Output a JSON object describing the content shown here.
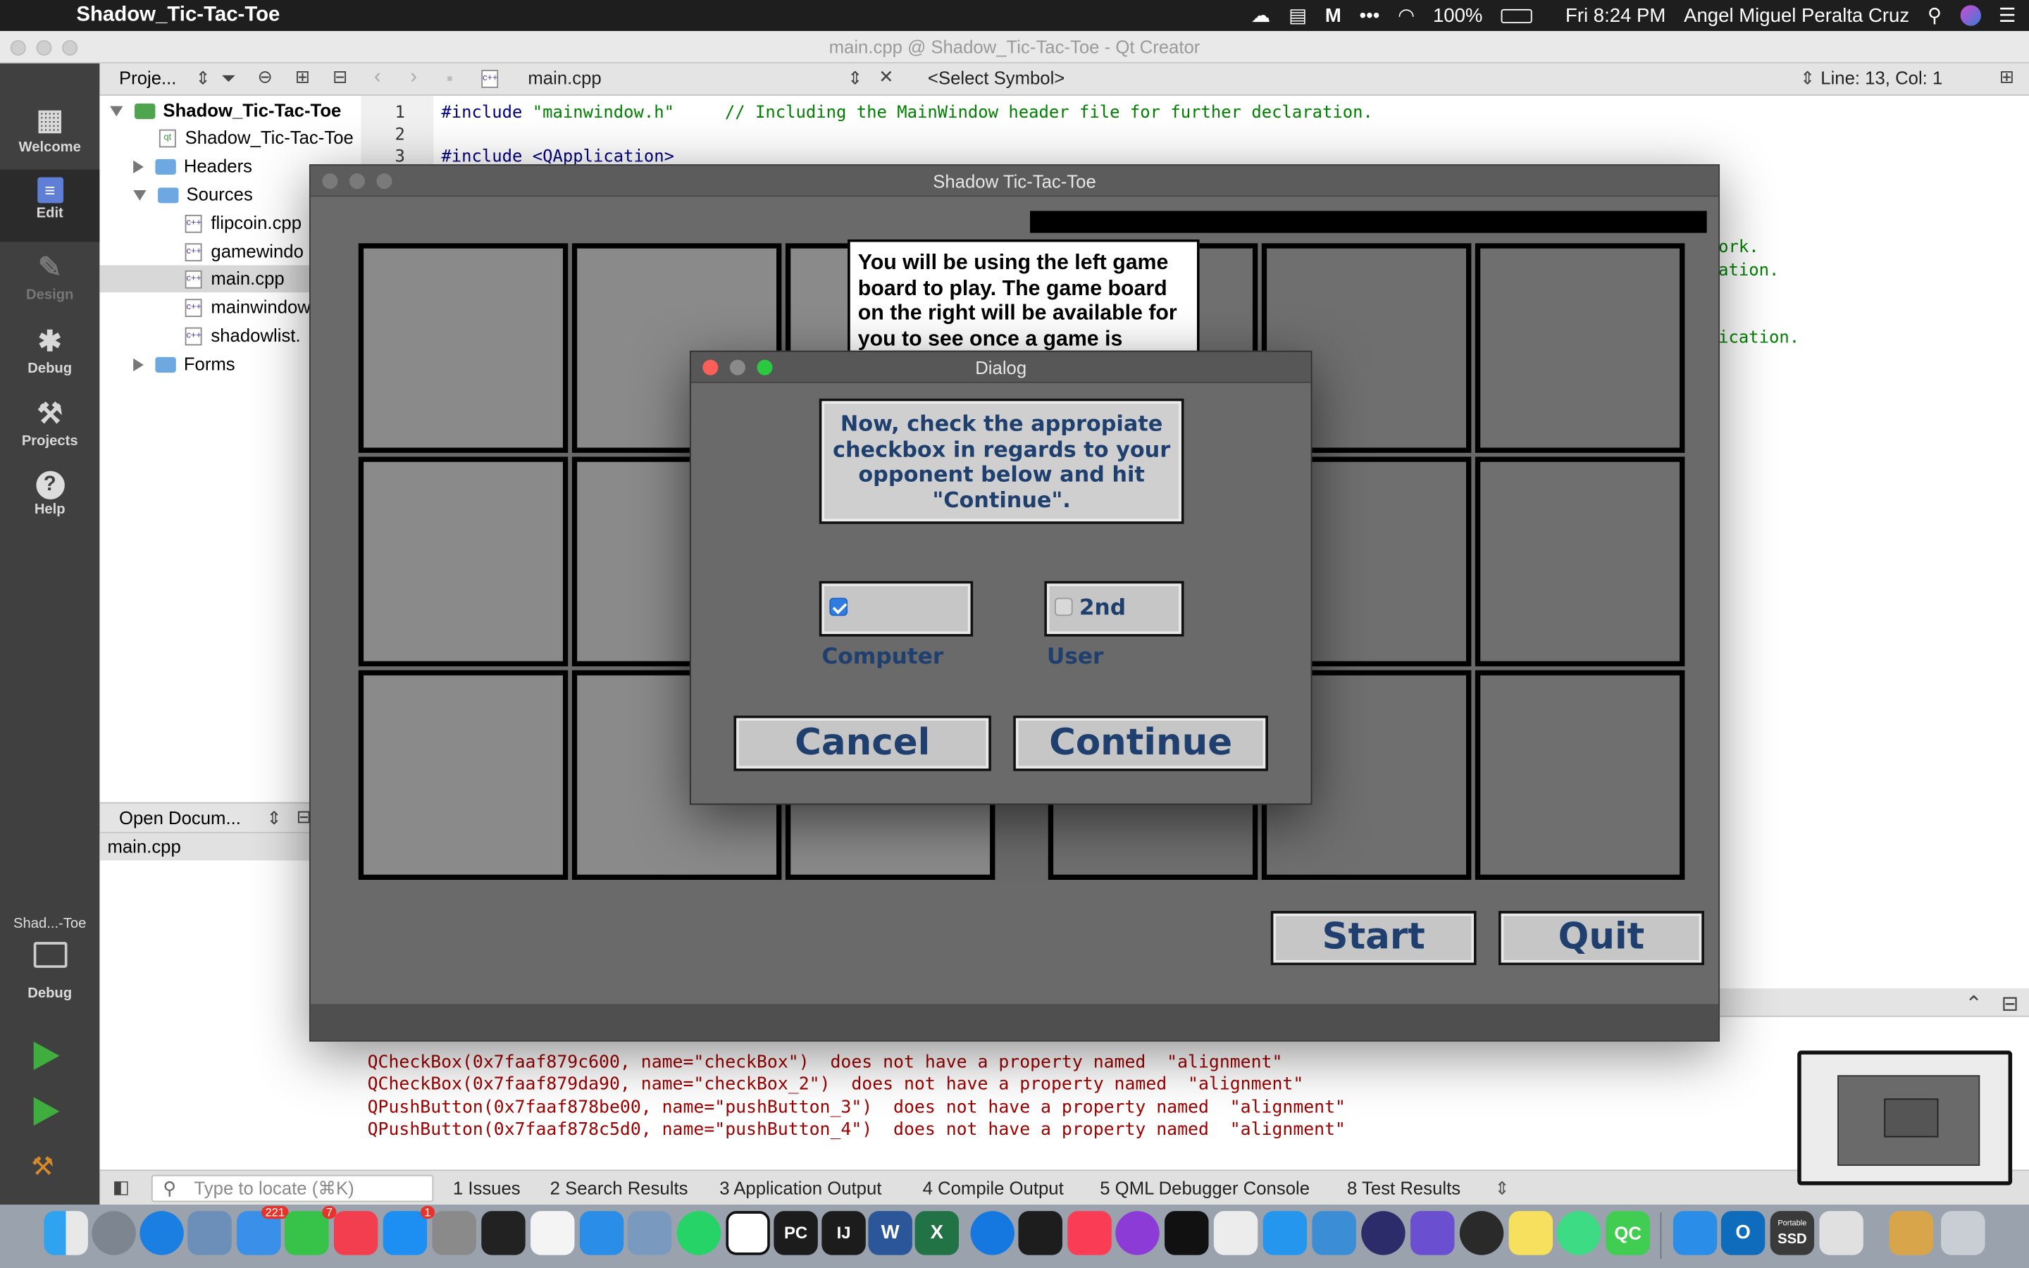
{
  "menubar": {
    "app_name": "Shadow_Tic-Tac-Toe",
    "battery": "100%",
    "clock": "Fri 8:24 PM",
    "user": "Angel Miguel Peralta Cruz"
  },
  "window_title": "main.cpp @ Shadow_Tic-Tac-Toe - Qt Creator",
  "modes": [
    {
      "label": "Welcome",
      "icon": "grid-icon"
    },
    {
      "label": "Edit",
      "icon": "document-icon"
    },
    {
      "label": "Design",
      "icon": "pencil-icon"
    },
    {
      "label": "Debug",
      "icon": "bug-icon"
    },
    {
      "label": "Projects",
      "icon": "wrench-icon"
    },
    {
      "label": "Help",
      "icon": "question-icon"
    }
  ],
  "target": {
    "name": "Shad...-Toe",
    "mode": "Debug"
  },
  "navigator": {
    "selector": "Proje...",
    "project": "Shadow_Tic-Tac-Toe",
    "pro_file": "Shadow_Tic-Tac-Toe",
    "headers": "Headers",
    "sources": "Sources",
    "files": [
      "flipcoin.cpp",
      "gamewindo",
      "main.cpp",
      "mainwindow",
      "shadowlist."
    ],
    "forms": "Forms"
  },
  "open_docs": {
    "label": "Open Docum...",
    "items": [
      "main.cpp"
    ]
  },
  "editor": {
    "file": "main.cpp",
    "symbol": "<Select Symbol>",
    "position": "Line: 13, Col: 1",
    "line_numbers": [
      "1",
      "2",
      "3"
    ],
    "line1_directive": "#include",
    "line1_string": "\"mainwindow.h\"",
    "line1_comment": "// Including the MainWindow header file for further declaration.",
    "line3": "#include <QApplication>",
    "peek1": "ork.",
    "peek2": "ation.",
    "peek3": "ication."
  },
  "output_lines": [
    "QCheckBox(0x7faaf879c600, name=\"checkBox\")  does not have a property named  \"alignment\"",
    "QCheckBox(0x7faaf879da90, name=\"checkBox_2\")  does not have a property named  \"alignment\"",
    "QPushButton(0x7faaf878be00, name=\"pushButton_3\")  does not have a property named  \"alignment\"",
    "QPushButton(0x7faaf878c5d0, name=\"pushButton_4\")  does not have a property named  \"alignment\""
  ],
  "statusbar": {
    "locate_placeholder": "Type to locate (⌘K)",
    "tabs": [
      {
        "num": "1",
        "label": "Issues"
      },
      {
        "num": "2",
        "label": "Search Results"
      },
      {
        "num": "3",
        "label": "Application Output"
      },
      {
        "num": "4",
        "label": "Compile Output"
      },
      {
        "num": "5",
        "label": "QML Debugger Console"
      },
      {
        "num": "8",
        "label": "Test Results"
      }
    ]
  },
  "game": {
    "title": "Shadow Tic-Tac-Toe",
    "info": "You will be using the left game board to play. The game board on the right will be available for you to see once a game is",
    "start": "Start",
    "quit": "Quit"
  },
  "dialog": {
    "title": "Dialog",
    "message": "Now, check the appropiate checkbox in regards to your opponent below and hit \"Continue\".",
    "computer_label": "Computer",
    "computer_checked": true,
    "second_user_label": "2nd User",
    "second_user_checked": false,
    "cancel": "Cancel",
    "continue": "Continue"
  },
  "dock_badges": {
    "mail": "221",
    "facetime": "7",
    "appstore": "1"
  },
  "dock_labels": {
    "pycharm": "PC",
    "intellij": "IJ",
    "word": "W",
    "excel": "X",
    "qt": "QC",
    "outlook": "O",
    "ssd_top": "Portable",
    "ssd": "SSD"
  }
}
